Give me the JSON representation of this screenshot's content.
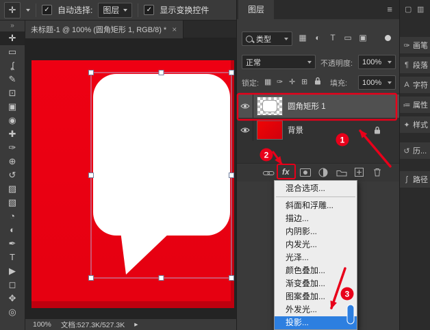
{
  "options_bar": {
    "tool_glyph": "✛",
    "check_glyph": "✓",
    "auto_select_label": "自动选择:",
    "target_select_value": "图层",
    "show_transform_label": "显示变换控件"
  },
  "document_tab": {
    "title": "未标题-1 @ 100% (圆角矩形 1, RGB/8) *",
    "close_glyph": "×"
  },
  "status_bar": {
    "zoom": "100%",
    "doc_info": "文档:527.3K/527.3K",
    "chevron": "▸"
  },
  "tools": {
    "collapse_glyph": "»",
    "items": [
      {
        "name": "move-tool",
        "glyph": "✛"
      },
      {
        "name": "rectangular-marquee-tool",
        "glyph": "▭"
      },
      {
        "name": "lasso-tool",
        "glyph": "ʆ"
      },
      {
        "name": "quick-selection-tool",
        "glyph": "✎"
      },
      {
        "name": "crop-tool",
        "glyph": "⊡"
      },
      {
        "name": "frame-tool",
        "glyph": "▣"
      },
      {
        "name": "eyedropper-tool",
        "glyph": "◉"
      },
      {
        "name": "spot-healing-brush-tool",
        "glyph": "✚"
      },
      {
        "name": "brush-tool",
        "glyph": "✑"
      },
      {
        "name": "clone-stamp-tool",
        "glyph": "⊕"
      },
      {
        "name": "history-brush-tool",
        "glyph": "↺"
      },
      {
        "name": "eraser-tool",
        "glyph": "▨"
      },
      {
        "name": "gradient-tool",
        "glyph": "▧"
      },
      {
        "name": "blur-tool",
        "glyph": "◔"
      },
      {
        "name": "dodge-tool",
        "glyph": "◐"
      },
      {
        "name": "pen-tool",
        "glyph": "✒"
      },
      {
        "name": "type-tool",
        "glyph": "T"
      },
      {
        "name": "path-selection-tool",
        "glyph": "▶"
      },
      {
        "name": "rectangle-tool",
        "glyph": "◻"
      },
      {
        "name": "hand-tool",
        "glyph": "✥"
      },
      {
        "name": "zoom-tool",
        "glyph": "◎"
      }
    ]
  },
  "layers_panel": {
    "tab_title": "图层",
    "menu_glyph": "≡",
    "filter": {
      "type_label": "类型",
      "icons": [
        {
          "name": "filter-pixel-layers-icon",
          "glyph": "▦"
        },
        {
          "name": "filter-adjustment-layers-icon",
          "glyph": "◐"
        },
        {
          "name": "filter-type-layers-icon",
          "glyph": "T"
        },
        {
          "name": "filter-shape-layers-icon",
          "glyph": "▭"
        },
        {
          "name": "filter-smart-objects-icon",
          "glyph": "▣"
        }
      ]
    },
    "blend": {
      "mode": "正常",
      "opacity_label": "不透明度:",
      "opacity_value": "100%"
    },
    "lock": {
      "label": "锁定:",
      "icons": [
        {
          "name": "lock-transparent-pixels-icon",
          "glyph": "▦"
        },
        {
          "name": "lock-image-pixels-icon",
          "glyph": "✑"
        },
        {
          "name": "lock-position-icon",
          "glyph": "✛"
        },
        {
          "name": "lock-artboard-icon",
          "glyph": "⊞"
        }
      ],
      "fill_label": "填充:",
      "fill_value": "100%"
    },
    "layers": [
      {
        "name": "圆角矩形 1",
        "selected": true,
        "locked": false
      },
      {
        "name": "背景",
        "selected": false,
        "locked": true
      }
    ],
    "footer": {
      "fx_label": "fx"
    }
  },
  "fx_menu": {
    "items": [
      "混合选项...",
      "斜面和浮雕...",
      "描边...",
      "内阴影...",
      "内发光...",
      "光泽...",
      "颜色叠加...",
      "渐变叠加...",
      "图案叠加...",
      "外发光...",
      "投影..."
    ],
    "highlighted_item": "投影..."
  },
  "right_dock": {
    "header_icons": [
      "▢",
      "▥"
    ],
    "tabs": [
      {
        "name": "brush",
        "glyph": "✑",
        "label": "画笔"
      },
      {
        "name": "paragraph",
        "glyph": "¶",
        "label": "段落"
      },
      {
        "name": "character",
        "glyph": "A",
        "label": "字符"
      },
      {
        "name": "properties",
        "glyph": "≔",
        "label": "属性"
      },
      {
        "name": "styles",
        "glyph": "✦",
        "label": "样式"
      },
      {
        "name": "history",
        "glyph": "↺",
        "label": "历..."
      },
      {
        "name": "paths",
        "glyph": "ʃ",
        "label": "路径"
      }
    ]
  },
  "annotations": {
    "step1": "1",
    "step2": "2",
    "step3": "3"
  },
  "colors": {
    "canvas_red": "#e60011",
    "menu_highlight_blue": "#2d7fe0",
    "annotation_red": "#e8001a",
    "selected_layer_gray": "#505050"
  }
}
